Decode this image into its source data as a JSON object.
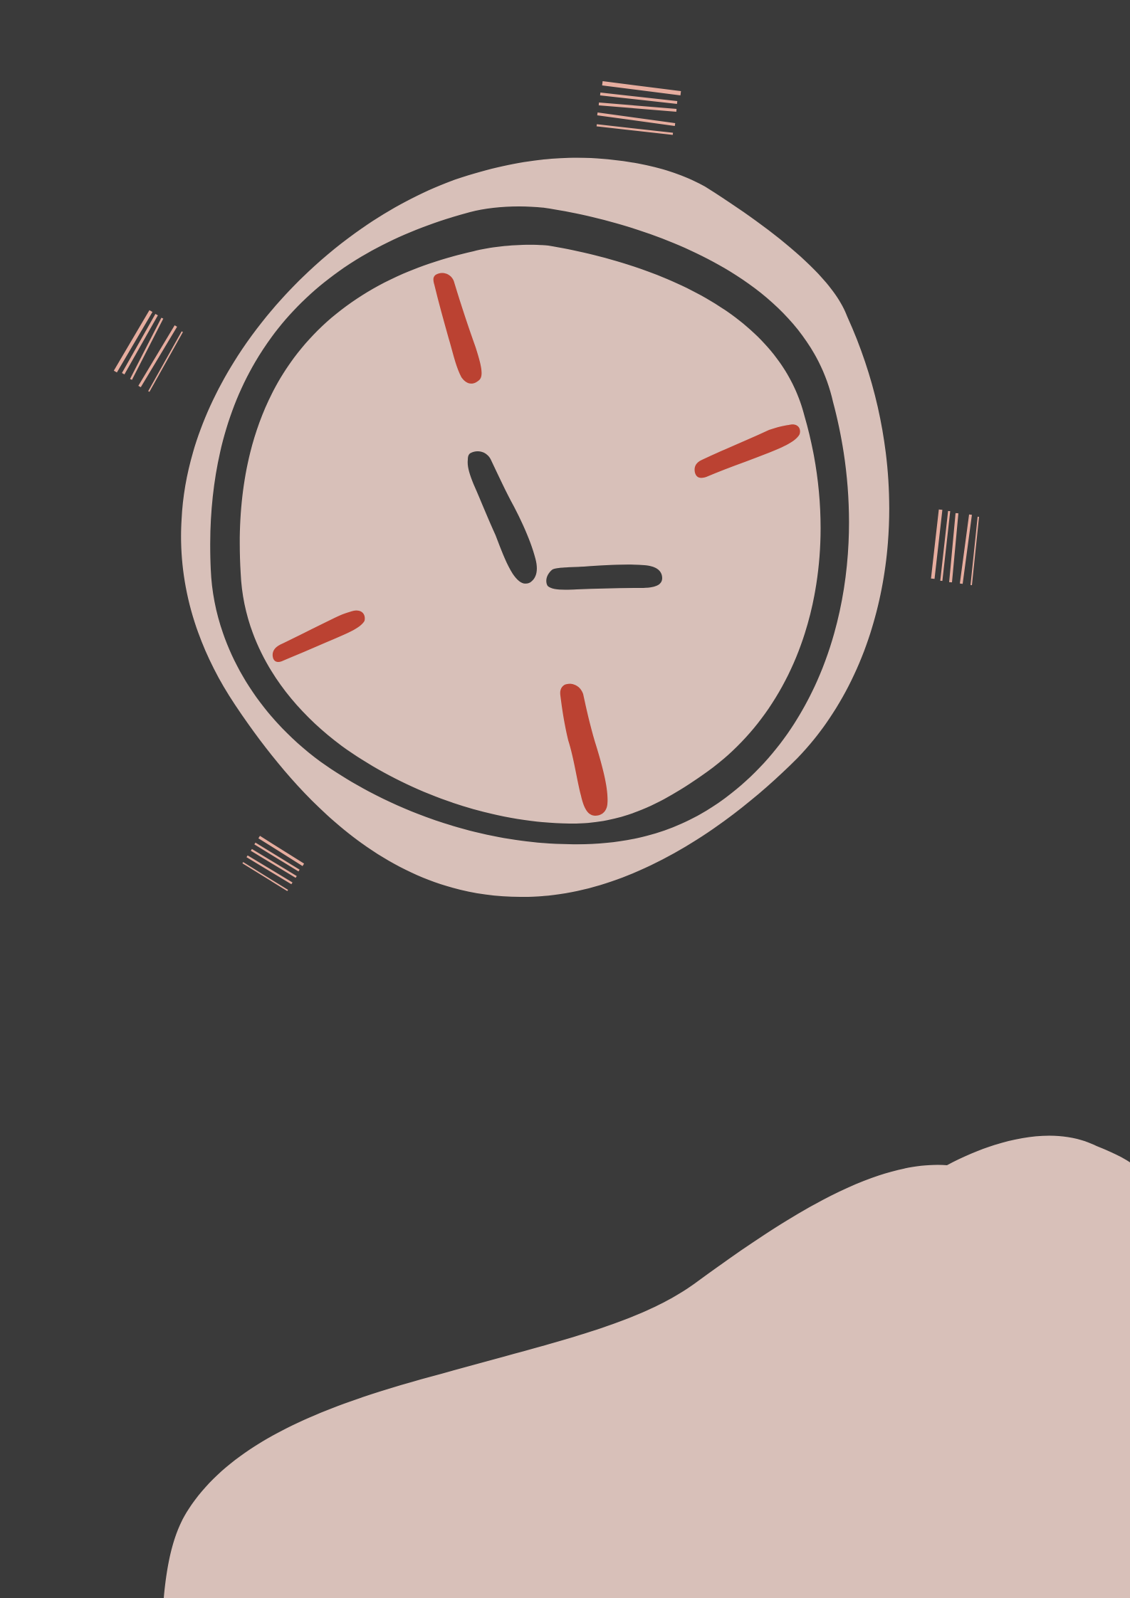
{
  "colors": {
    "background": "#3a3a3a",
    "blush": "#d8c0b9",
    "dark": "#3a3a3a",
    "accent_red": "#bb4232",
    "tick_pink": "#e6ad9f"
  },
  "icons": {
    "clock": "stylized-wall-clock-icon",
    "motion_lines": "vibration-lines-icon"
  },
  "clock": {
    "hour_markers": 4,
    "hands": 2
  }
}
